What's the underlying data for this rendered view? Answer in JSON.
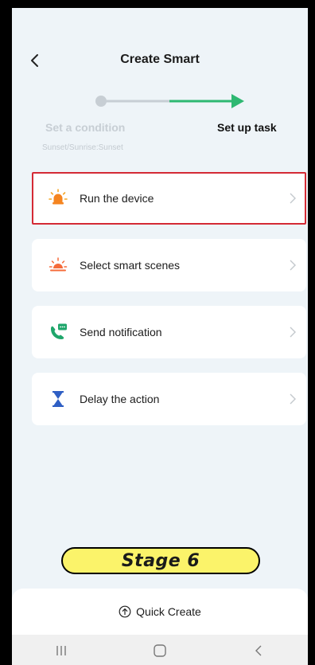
{
  "header": {
    "title": "Create Smart",
    "back_icon": "chevron-left-icon"
  },
  "stepper": {
    "step1_label": "Set a condition",
    "step1_sub": "Sunset/Sunrise:Sunset",
    "step2_label": "Set up task",
    "inactive_color": "#c7ced4",
    "active_color": "#2eb872"
  },
  "actions": [
    {
      "label": "Run the device",
      "icon": "bulb-icon",
      "highlighted": true
    },
    {
      "label": "Select smart scenes",
      "icon": "sunrise-icon",
      "highlighted": false
    },
    {
      "label": "Send notification",
      "icon": "phone-message-icon",
      "highlighted": false
    },
    {
      "label": "Delay the action",
      "icon": "hourglass-icon",
      "highlighted": false
    }
  ],
  "stage_label": "Stage 6",
  "quick_create": {
    "label": "Quick Create",
    "icon": "arrow-up-circle-icon"
  },
  "nav": {
    "recents_icon": "recents-icon",
    "home_icon": "home-icon",
    "back_icon": "back-icon"
  },
  "colors": {
    "highlight": "#d42a35",
    "stage_bg": "#fbf36a",
    "background": "#eef4f8"
  }
}
